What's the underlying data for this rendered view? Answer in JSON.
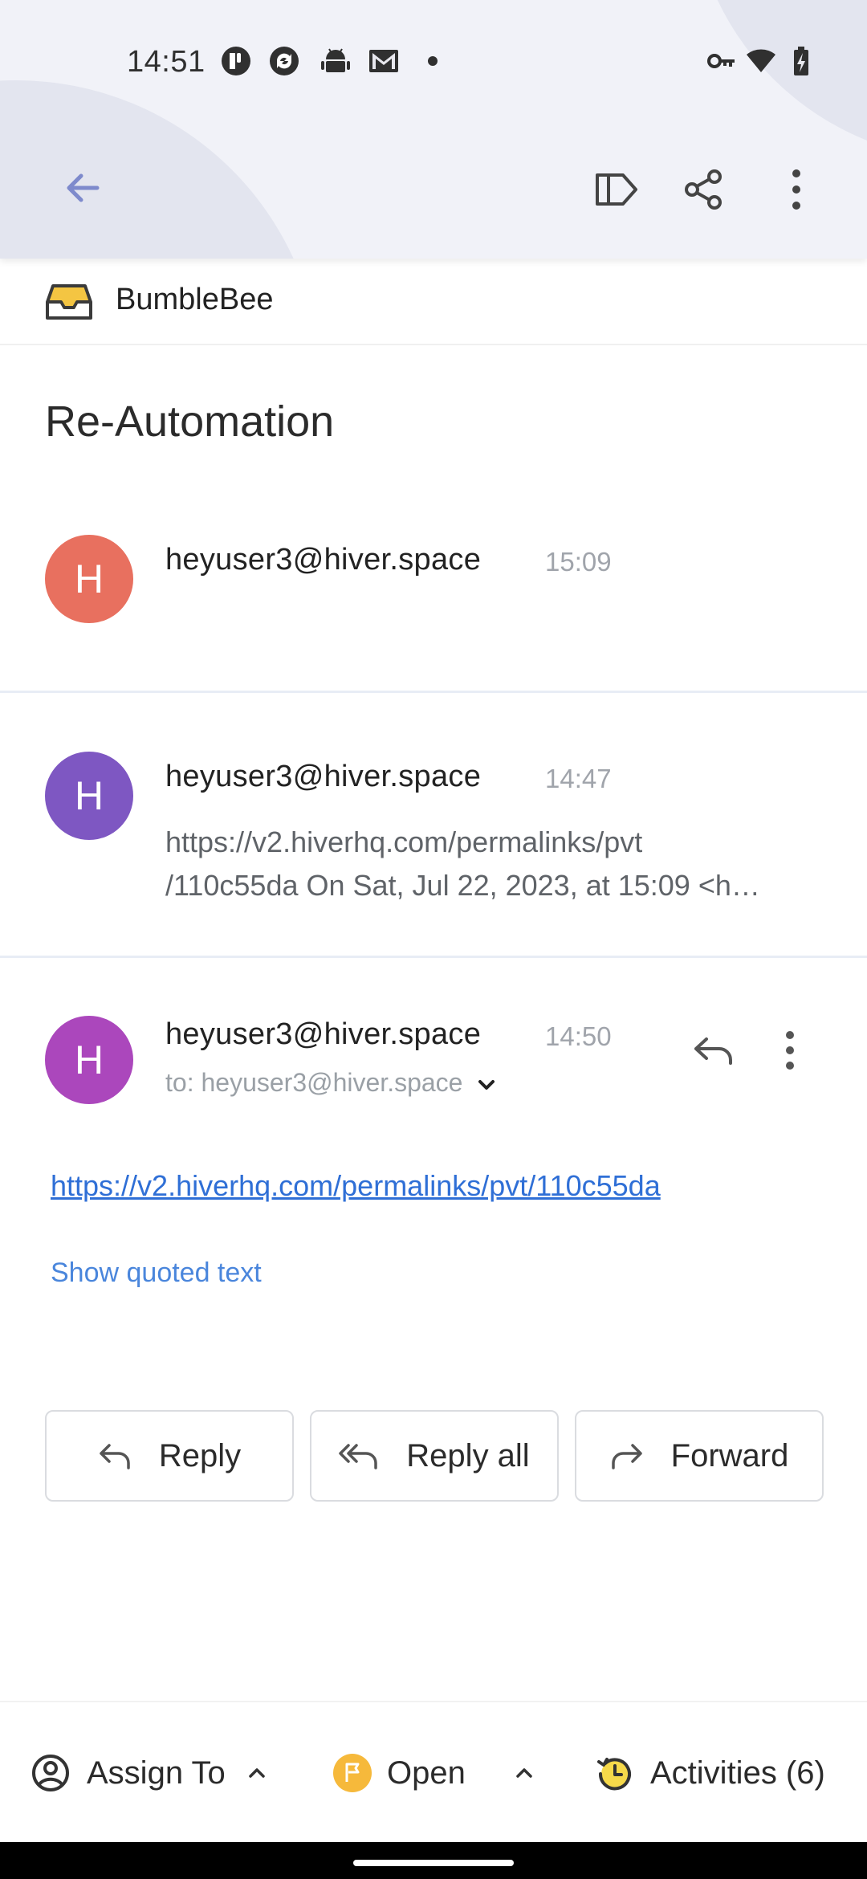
{
  "status_bar": {
    "time": "14:51"
  },
  "inbox": {
    "name": "BumbleBee"
  },
  "subject": "Re-Automation",
  "messages": [
    {
      "sender": "heyuser3@hiver.space",
      "time": "15:09",
      "avatar_letter": "H",
      "avatar_color": "#e8705f"
    },
    {
      "sender": "heyuser3@hiver.space",
      "time": "14:47",
      "avatar_letter": "H",
      "avatar_color": "#7e57c2",
      "snippet_line1": "https://v2.hiverhq.com/permalinks/pvt",
      "snippet_line2": "/110c55da On Sat, Jul 22, 2023, at 15:09 <h…"
    },
    {
      "sender": "heyuser3@hiver.space",
      "time": "14:50",
      "avatar_letter": "H",
      "avatar_color": "#ab47bc",
      "to": "to: heyuser3@hiver.space",
      "body_link": "https://v2.hiverhq.com/permalinks/pvt/110c55da",
      "show_quoted": "Show quoted text"
    }
  ],
  "actions": {
    "reply": "Reply",
    "reply_all": "Reply all",
    "forward": "Forward"
  },
  "bottom_bar": {
    "assign": "Assign To",
    "status": "Open",
    "activities": "Activities (6)"
  },
  "colors": {
    "accent_link": "#2f6fd6",
    "status_open": "#f6b93b"
  }
}
